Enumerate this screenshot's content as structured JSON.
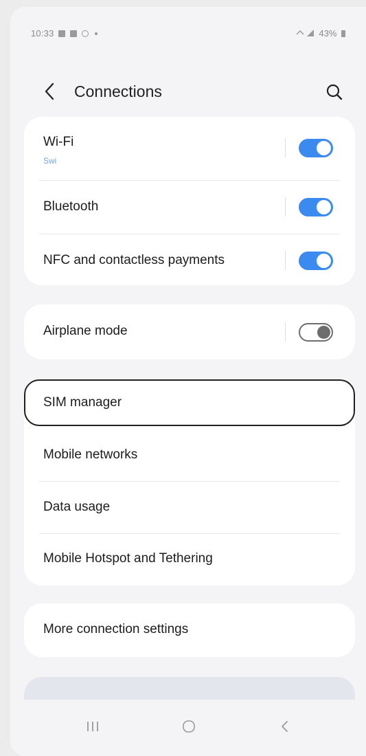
{
  "status_bar": {
    "time": "10:33",
    "battery": "43%"
  },
  "header": {
    "title": "Connections"
  },
  "group1": [
    {
      "label": "Wi-Fi",
      "sub": "Swi",
      "toggle": "on"
    },
    {
      "label": "Bluetooth",
      "toggle": "on"
    },
    {
      "label": "NFC and contactless payments",
      "toggle": "on"
    }
  ],
  "group2": [
    {
      "label": "Airplane mode",
      "toggle": "off"
    }
  ],
  "group3": [
    {
      "label": "SIM manager"
    },
    {
      "label": "Mobile networks"
    },
    {
      "label": "Data usage"
    },
    {
      "label": "Mobile Hotspot and Tethering"
    }
  ],
  "group4": [
    {
      "label": "More connection settings"
    }
  ],
  "colors": {
    "accent": "#3a8af0",
    "background": "#f4f4f6"
  },
  "icons": {
    "back": "chevron-left-icon",
    "search": "search-icon",
    "recents": "recents-icon",
    "home": "home-icon",
    "nav_back": "nav-back-icon"
  }
}
